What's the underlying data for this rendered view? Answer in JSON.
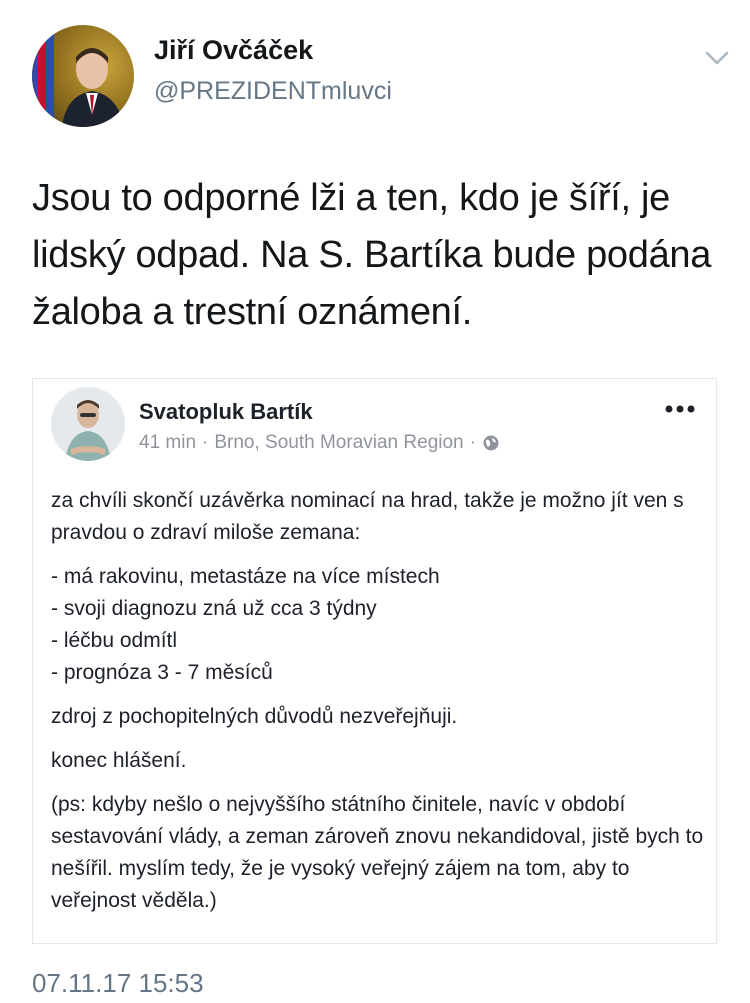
{
  "tweet": {
    "author_name": "Jiří Ovčáček",
    "author_handle": "@PREZIDENTmluvci",
    "text": "Jsou to odporné lži a ten, kdo je šíří, je lidský odpad. Na S. Bartíka bude podána žaloba a trestní oznámení.",
    "timestamp": "07.11.17 15:53",
    "icons": {
      "menu": "chevron-down-icon"
    }
  },
  "quoted_post": {
    "author_name": "Svatopluk Bartík",
    "time": "41 min",
    "location": "Brno, South Moravian Region",
    "icons": {
      "privacy": "globe-icon",
      "more": "more-horizontal-icon"
    },
    "paragraph_1": "za chvíli skončí uzávěrka nominací na hrad, takže je možno jít ven s pravdou o zdraví miloše zemana:",
    "list_items": [
      "- má rakovinu, metastáze na více místech",
      "- svoji diagnozu zná už cca 3 týdny",
      "- léčbu odmítl",
      "- prognóza 3 - 7 měsíců"
    ],
    "paragraph_2": "zdroj z pochopitelných důvodů nezveřejňuji.",
    "paragraph_3": "konec hlášení.",
    "paragraph_4": "(ps: kdyby nešlo o nejvyššího státního činitele, navíc v období sestavování vlády, a zeman zároveň znovu nekandidoval, jistě bych to nešířil. myslím tedy, že je vysoký veřejný zájem na tom, aby to veřejnost věděla.)"
  }
}
